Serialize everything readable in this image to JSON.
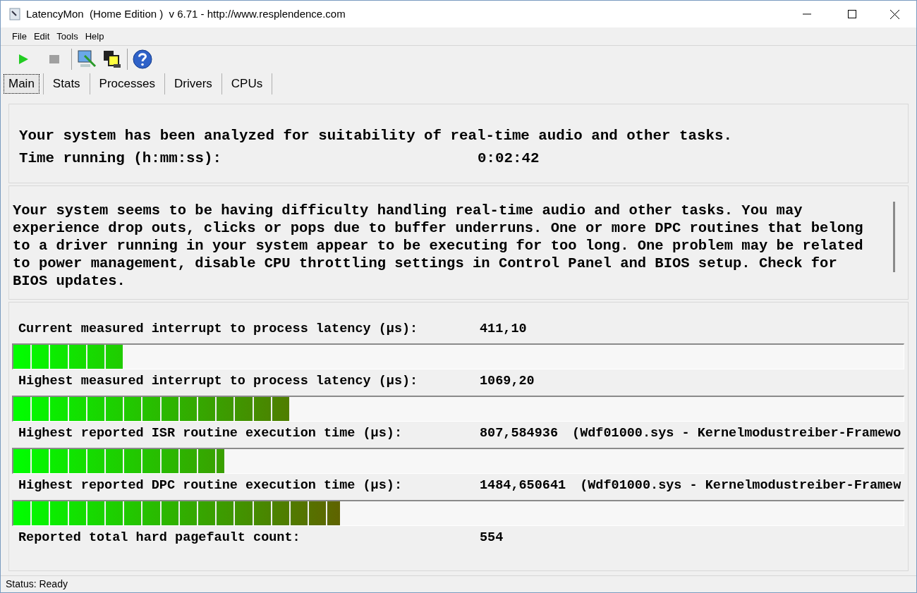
{
  "window": {
    "title": "LatencyMon  (Home Edition )  v 6.71 - http://www.resplendence.com"
  },
  "menu": [
    "File",
    "Edit",
    "Tools",
    "Help"
  ],
  "tabs": [
    {
      "label": "Main",
      "selected": true
    },
    {
      "label": "Stats",
      "selected": false
    },
    {
      "label": "Processes",
      "selected": false
    },
    {
      "label": "Drivers",
      "selected": false
    },
    {
      "label": "CPUs",
      "selected": false
    }
  ],
  "summary": {
    "headline": "Your system has been analyzed for suitability of real-time audio and other tasks.",
    "time_label": "Time running (h:mm:ss):",
    "time_value": "0:02:42"
  },
  "verdict": "Your system seems to be having difficulty handling real-time audio and other tasks. You may experience drop outs, clicks or pops due to buffer underruns. One or more DPC routines that belong to a driver running in your system appear to be executing for too long. One problem may be related to power management, disable CPU throttling settings in Control Panel and BIOS setup. Check for BIOS updates.",
  "measurements": [
    {
      "kind": "meter",
      "label": "Current measured interrupt to process latency (µs):",
      "value": "411,10",
      "level": 0.123
    },
    {
      "kind": "meter",
      "label": "Highest measured interrupt to process latency (µs):",
      "value": "1069,20",
      "level": 0.31
    },
    {
      "kind": "meter",
      "label": "Highest reported ISR routine execution time (µs):",
      "value": "807,584936",
      "note": "(Wdf01000.sys - Kernelmodustreiber-Framewo",
      "level": 0.237
    },
    {
      "kind": "meter",
      "label": "Highest reported DPC routine execution time (µs):",
      "value": "1484,650641",
      "note": "(Wdf01000.sys - Kernelmodustreiber-Framew",
      "level": 0.367
    },
    {
      "kind": "plain",
      "label": "Reported total hard pagefault count:",
      "value": "554"
    }
  ],
  "status_bar": "Status: Ready"
}
